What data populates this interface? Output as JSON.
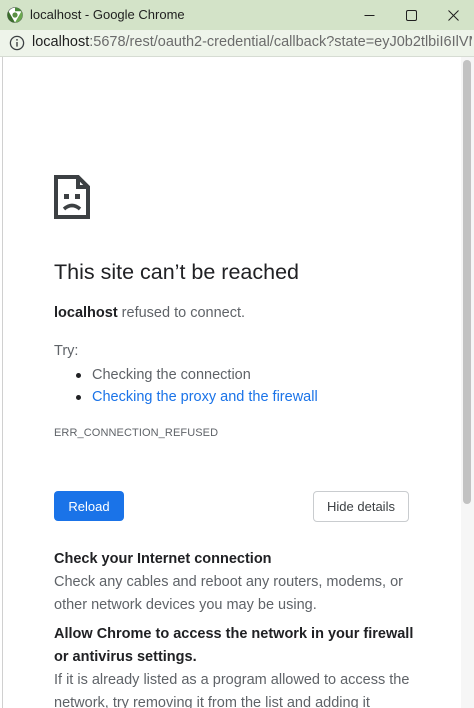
{
  "window": {
    "title": "localhost - Google Chrome",
    "controls": {
      "minimize": "minimize",
      "maximize": "maximize",
      "close": "close"
    }
  },
  "address_bar": {
    "url_host": "localhost",
    "url_rest": ":5678/rest/oauth2-credential/callback?state=eyJ0b2tlbiI6IlVM..."
  },
  "error_page": {
    "heading": "This site can’t be reached",
    "host": "localhost",
    "message": " refused to connect.",
    "try_label": "Try:",
    "suggestions": [
      {
        "text": "Checking the connection",
        "link": false
      },
      {
        "text": "Checking the proxy and the firewall",
        "link": true
      }
    ],
    "error_code": "ERR_CONNECTION_REFUSED",
    "reload_label": "Reload",
    "details_label": "Hide details",
    "details": [
      {
        "title": "Check your Internet connection",
        "body": "Check any cables and reboot any routers, modems, or other network devices you may be using."
      },
      {
        "title": "Allow Chrome to access the network in your firewall or antivirus settings.",
        "body": "If it is already listed as a program allowed to access the network, try removing it from the list and adding it"
      }
    ]
  },
  "colors": {
    "titlebar": "#d3e3c8",
    "link": "#1a73e8",
    "button": "#1a73e8",
    "heading": "#202124",
    "body_text": "#5f6368"
  },
  "icons": {
    "app": "chrome-icon",
    "site_info": "info-icon",
    "error": "sad-document-icon"
  }
}
